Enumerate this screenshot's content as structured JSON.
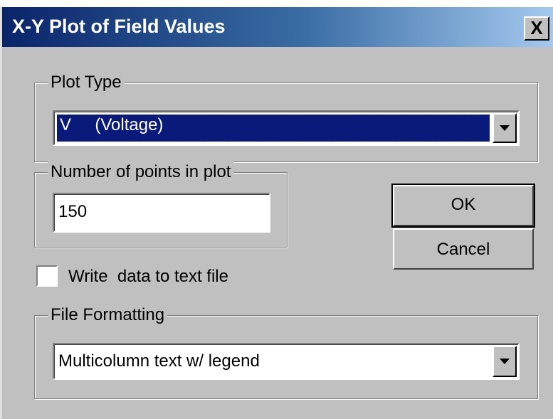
{
  "window": {
    "title": "X-Y Plot of Field Values",
    "close_label": "X"
  },
  "plot_type": {
    "legend": "Plot Type",
    "selected": "V     (Voltage)"
  },
  "points": {
    "legend": "Number of points in plot",
    "value": "150"
  },
  "buttons": {
    "ok": "OK",
    "cancel": "Cancel"
  },
  "write_checkbox": {
    "label": "Write  data to text file",
    "checked": false
  },
  "file_formatting": {
    "legend": "File Formatting",
    "selected": "Multicolumn text w/ legend"
  },
  "colors": {
    "titlebar_start": "#0a246a",
    "titlebar_end": "#a6caf0",
    "face": "#c0c0c0",
    "selection": "#0a1a7a"
  }
}
